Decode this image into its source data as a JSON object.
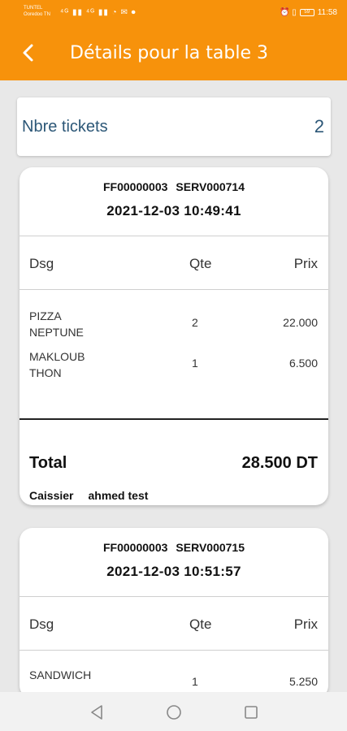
{
  "status_bar": {
    "carrier_line1": "TUNTEL",
    "carrier_line2": "Ooredoo TN",
    "left_icons": "⁴ᴳ ▮▮ ⁴ᴳ ▮▮ ◔ ✉ ⏺",
    "right_icons": "⏰ ▯",
    "battery": "59",
    "time": "11:58"
  },
  "app_bar": {
    "title": "Détails pour la table 3",
    "back_icon": "chevron-left-icon"
  },
  "summary": {
    "label": "Nbre tickets",
    "value": "2"
  },
  "tickets": [
    {
      "invoice": "FF00000003",
      "server": "SERV000714",
      "datetime": "2021-12-03 10:49:41",
      "columns": {
        "dsg": "Dsg",
        "qte": "Qte",
        "prix": "Prix"
      },
      "items": [
        {
          "dsg": "PIZZA NEPTUNE",
          "qte": "2",
          "prix": "22.000"
        },
        {
          "dsg": "MAKLOUB THON",
          "qte": "1",
          "prix": "6.500"
        }
      ],
      "total_label": "Total",
      "total_value": "28.500 DT",
      "cashier_label": "Caissier",
      "cashier_name": "ahmed test"
    },
    {
      "invoice": "FF00000003",
      "server": "SERV000715",
      "datetime": "2021-12-03 10:51:57",
      "columns": {
        "dsg": "Dsg",
        "qte": "Qte",
        "prix": "Prix"
      },
      "items": [
        {
          "dsg": "SANDWICH",
          "qte": "1",
          "prix": "5.250"
        }
      ]
    }
  ],
  "nav_bar": {
    "back": "triangle-back-icon",
    "home": "circle-home-icon",
    "recents": "square-recents-icon"
  },
  "colors": {
    "accent": "#f7920b",
    "summary_text": "#2c5777"
  }
}
